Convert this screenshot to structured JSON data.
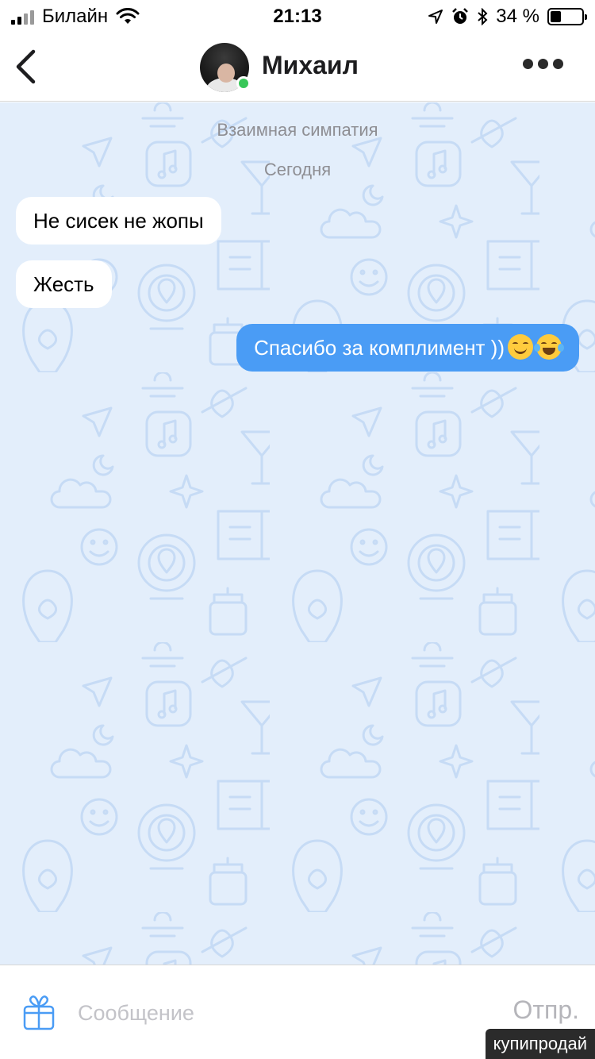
{
  "status_bar": {
    "carrier": "Билайн",
    "time": "21:13",
    "battery_percent": "34 %",
    "battery_level": 0.34
  },
  "header": {
    "contact_name": "Михаил",
    "online": true
  },
  "chat": {
    "system_match": "Взаимная симпатия",
    "date_divider": "Сегодня",
    "messages": [
      {
        "direction": "incoming",
        "text": "Не сисек не жопы"
      },
      {
        "direction": "incoming",
        "text": "Жесть"
      },
      {
        "direction": "outgoing",
        "text": "Спасибо за комплимент ))",
        "emojis": [
          "smiling-face",
          "tears-of-joy"
        ]
      }
    ]
  },
  "composer": {
    "placeholder": "Сообщение",
    "send_label": "Отпр."
  },
  "watermark": "купипродай",
  "colors": {
    "chat_background": "#e3eefb",
    "outgoing_bubble": "#4a9cf5",
    "online": "#38c759"
  },
  "icons": {
    "back": "chevron-left-icon",
    "more": "ellipsis-icon",
    "gift": "gift-icon",
    "wifi": "wifi-icon",
    "location": "location-arrow-icon",
    "alarm": "alarm-icon",
    "bluetooth": "bluetooth-icon"
  }
}
